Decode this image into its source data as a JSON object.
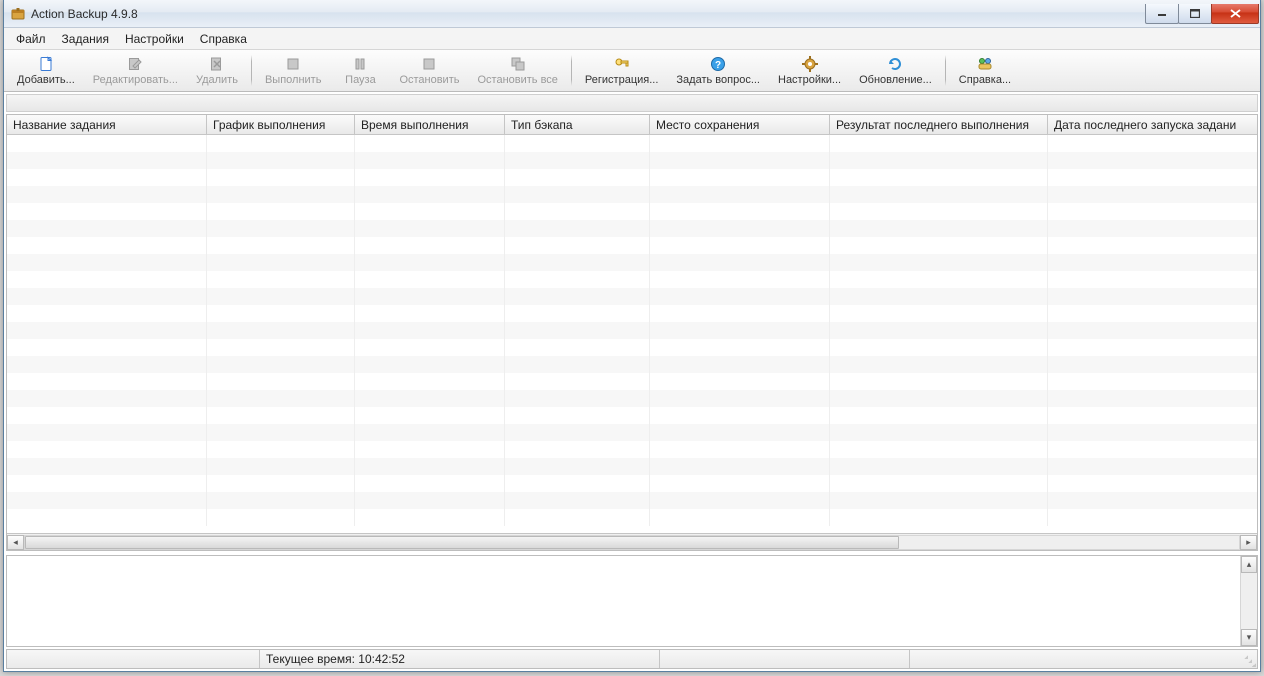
{
  "window": {
    "title": "Action Backup 4.9.8"
  },
  "menu": {
    "file": "Файл",
    "tasks": "Задания",
    "settings": "Настройки",
    "help": "Справка"
  },
  "toolbar": {
    "add": "Добавить...",
    "edit": "Редактировать...",
    "delete": "Удалить",
    "run": "Выполнить",
    "pause": "Пауза",
    "stop": "Остановить",
    "stop_all": "Остановить все",
    "register": "Регистрация...",
    "ask": "Задать вопрос...",
    "settings": "Настройки...",
    "update": "Обновление...",
    "help": "Справка..."
  },
  "columns": {
    "name": "Название задания",
    "schedule": "График выполнения",
    "time": "Время выполнения",
    "type": "Тип бэкапа",
    "location": "Место сохранения",
    "last_result": "Результат последнего выполнения",
    "last_run": "Дата последнего запуска задани"
  },
  "columnWidths": {
    "name": 200,
    "schedule": 148,
    "time": 150,
    "type": 145,
    "location": 180,
    "last_result": 218,
    "last_run": 200
  },
  "status": {
    "panel1_width": 253,
    "panel2_width": 400,
    "panel3_width": 250,
    "panel4_width": 1000,
    "current_time_label": "Текущее время: 10:42:52"
  }
}
